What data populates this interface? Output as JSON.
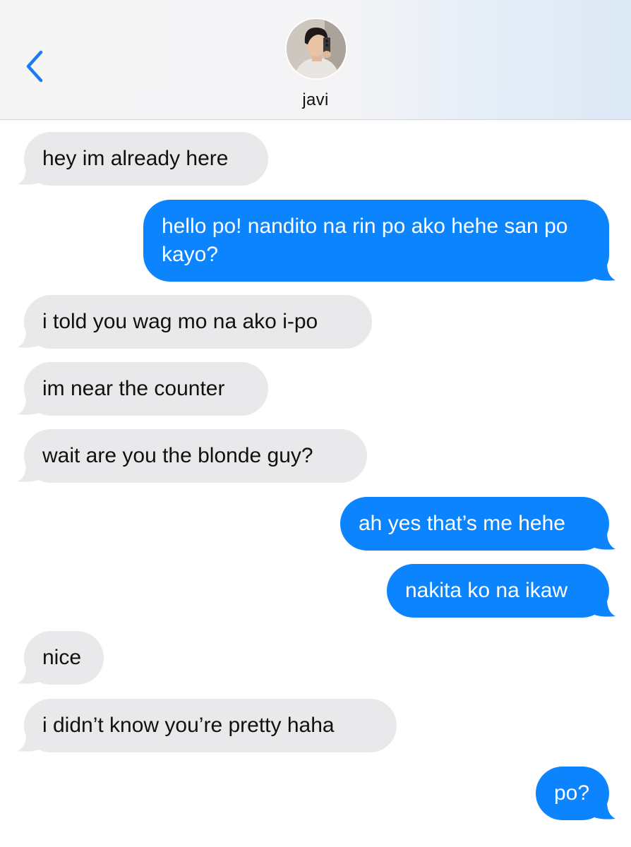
{
  "header": {
    "back_icon": "chevron-left-icon",
    "contact_name": "javi",
    "avatar_icon": "contact-avatar-photo",
    "accent_color": "#1a7cf5"
  },
  "colors": {
    "sent_bubble": "#0b84fe",
    "received_bubble": "#e9e9eb"
  },
  "messages": [
    {
      "direction": "received",
      "text": "hey im already here"
    },
    {
      "direction": "sent",
      "text": "hello po! nandito na rin po ako hehe san po kayo?"
    },
    {
      "direction": "received",
      "text": "i told you wag mo na ako i-po"
    },
    {
      "direction": "received",
      "text": "im near the counter"
    },
    {
      "direction": "received",
      "text": "wait are you the blonde guy?"
    },
    {
      "direction": "sent",
      "text": "ah yes that’s me hehe"
    },
    {
      "direction": "sent",
      "text": "nakita ko na ikaw"
    },
    {
      "direction": "received",
      "text": "nice"
    },
    {
      "direction": "received",
      "text": "i didn’t know you’re pretty haha"
    },
    {
      "direction": "sent",
      "text": "po?"
    }
  ]
}
